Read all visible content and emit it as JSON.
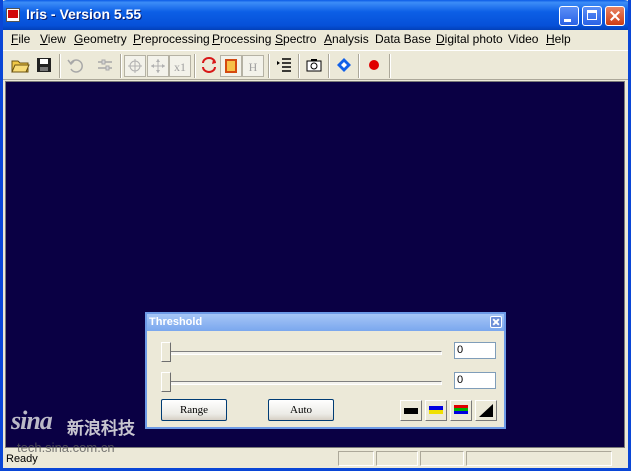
{
  "window": {
    "title": "Iris - Version 5.55"
  },
  "menu": [
    {
      "label": "File",
      "mnemonic": "F"
    },
    {
      "label": "View",
      "mnemonic": "V"
    },
    {
      "label": "Geometry",
      "mnemonic": "G"
    },
    {
      "label": "Preprocessing",
      "mnemonic": "P"
    },
    {
      "label": "Processing",
      "mnemonic": "P"
    },
    {
      "label": "Spectro",
      "mnemonic": "S"
    },
    {
      "label": "Analysis",
      "mnemonic": "A"
    },
    {
      "label": "Data Base",
      "mnemonic": ""
    },
    {
      "label": "Digital photo",
      "mnemonic": "D"
    },
    {
      "label": "Video",
      "mnemonic": ""
    },
    {
      "label": "Help",
      "mnemonic": "H"
    }
  ],
  "toolbar": {
    "icons": [
      "open-folder-icon",
      "save-icon",
      "undo-icon",
      "adjust-icon",
      "crosshair-icon",
      "move-icon",
      "x1-zoom",
      "rotate-icon",
      "palette-icon",
      "h-icon",
      "list-icon",
      "camera-icon",
      "diamond-icon",
      "record-icon"
    ],
    "x1_label": "x1",
    "h_label": "H"
  },
  "status": {
    "text": "Ready"
  },
  "threshold": {
    "title": "Threshold",
    "high_value": "0",
    "low_value": "0",
    "high_level": 0,
    "low_level": 0,
    "range_label": "Range",
    "auto_label": "Auto"
  },
  "watermark": {
    "logo": "sina",
    "cn": "新浪科技",
    "url": "tech.sina.com.cn"
  },
  "colors": {
    "canvas": "#0a0044",
    "titlebar": "#0650d8",
    "dialog_title": "#7aa7ee"
  }
}
